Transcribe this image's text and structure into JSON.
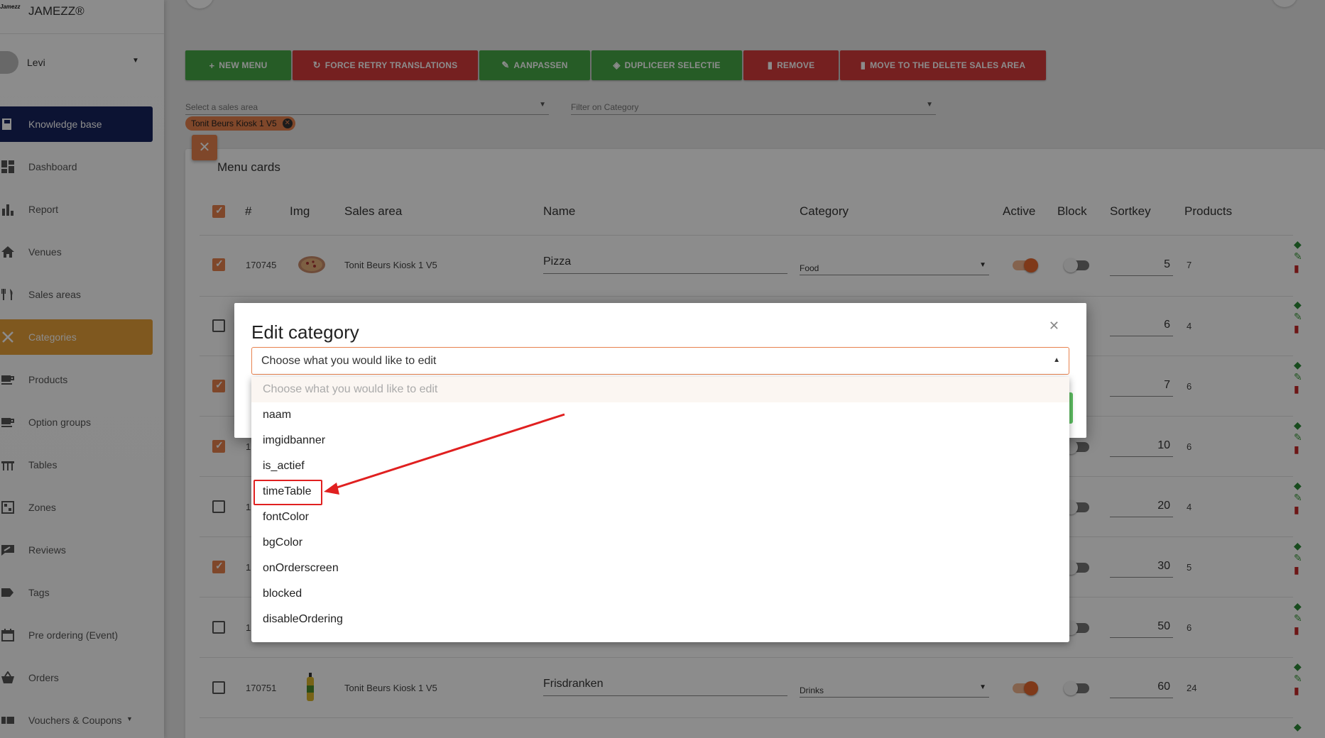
{
  "brand": {
    "logo": "Jamezz",
    "name": "JAMEZZ®"
  },
  "user": {
    "name": "Levi"
  },
  "sidebar": {
    "items": [
      {
        "label": "Knowledge base",
        "icon": "book-icon"
      },
      {
        "label": "Dashboard",
        "icon": "dashboard-icon"
      },
      {
        "label": "Report",
        "icon": "bar-chart-icon"
      },
      {
        "label": "Venues",
        "icon": "home-icon"
      },
      {
        "label": "Sales areas",
        "icon": "fork-knife-icon"
      },
      {
        "label": "Categories",
        "icon": "utensils-cross-icon"
      },
      {
        "label": "Products",
        "icon": "coffee-icon"
      },
      {
        "label": "Option groups",
        "icon": "coffee-icon"
      },
      {
        "label": "Tables",
        "icon": "table-icon"
      },
      {
        "label": "Zones",
        "icon": "zone-icon"
      },
      {
        "label": "Reviews",
        "icon": "review-icon"
      },
      {
        "label": "Tags",
        "icon": "tag-icon"
      },
      {
        "label": "Pre ordering (Event)",
        "icon": "calendar-icon"
      },
      {
        "label": "Orders",
        "icon": "basket-icon"
      },
      {
        "label": "Vouchers & Coupons",
        "icon": "ticket-icon"
      }
    ]
  },
  "toolbar": {
    "new_menu": "New menu",
    "force_retry": "Force retry translations",
    "aanpassen": "Aanpassen",
    "dupliceer": "Dupliceer selectie",
    "remove": "Remove",
    "move_delete": "Move to the delete sales area"
  },
  "filters": {
    "sales_area_placeholder": "Select a sales area",
    "category_placeholder": "Filter on Category",
    "chip": "Tonit Beurs Kiosk 1 V5"
  },
  "card": {
    "title": "Menu cards"
  },
  "table": {
    "headers": {
      "num": "#",
      "img": "Img",
      "sales_area": "Sales area",
      "name": "Name",
      "category": "Category",
      "active": "Active",
      "block": "Block",
      "sortkey": "Sortkey",
      "products": "Products"
    },
    "rows": [
      {
        "checked": true,
        "id": "170745",
        "sales_area": "Tonit Beurs Kiosk 1 V5",
        "name": "Pizza",
        "category": "Food",
        "active": true,
        "block": false,
        "sortkey": "5",
        "products": "7"
      },
      {
        "checked": false,
        "sortkey": "6",
        "products": "4"
      },
      {
        "checked": true,
        "sortkey": "7",
        "products": "6"
      },
      {
        "checked": true,
        "id_fragment": "1",
        "sortkey": "10",
        "products": "6"
      },
      {
        "checked": false,
        "id_fragment": "1",
        "sortkey": "20",
        "products": "4"
      },
      {
        "checked": true,
        "id_fragment": "1",
        "sortkey": "30",
        "products": "5"
      },
      {
        "checked": false,
        "id_fragment": "1",
        "sortkey": "50",
        "products": "6"
      },
      {
        "checked": false,
        "id": "170751",
        "sales_area": "Tonit Beurs Kiosk 1 V5",
        "name": "Frisdranken",
        "category": "Drinks",
        "active": true,
        "block": false,
        "sortkey": "60",
        "products": "24"
      }
    ]
  },
  "modal": {
    "title": "Edit category",
    "select_value": "Choose what you would like to edit",
    "options": [
      "Choose what you would like to edit",
      "naam",
      "imgidbanner",
      "is_actief",
      "timeTable",
      "fontColor",
      "bgColor",
      "onOrderscreen",
      "blocked",
      "disableOrdering"
    ]
  },
  "colors": {
    "accent": "#e8824e",
    "nav_active": "#e8a03a",
    "knowledge_base": "#17235e",
    "green": "#46a846",
    "red": "#d53b3b",
    "annotation": "#e02020"
  }
}
